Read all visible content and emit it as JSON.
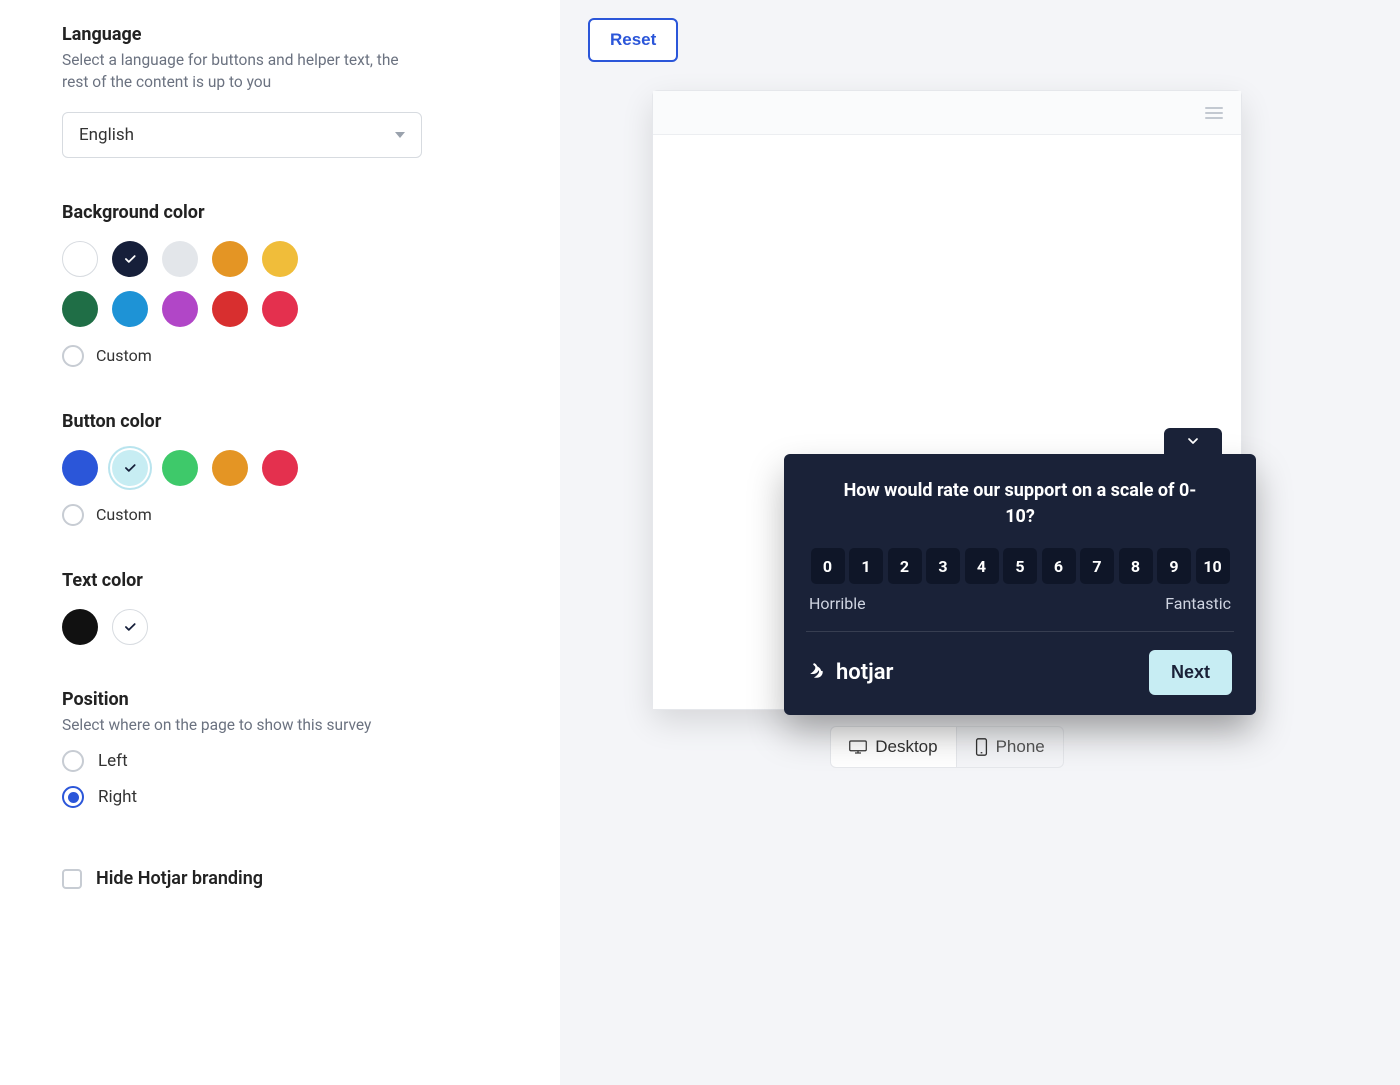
{
  "reset_label": "Reset",
  "language": {
    "title": "Language",
    "help": "Select a language for buttons and helper text, the rest of the content is up to you",
    "selected": "English"
  },
  "background": {
    "title": "Background color",
    "custom_label": "Custom",
    "swatches": [
      "#ffffff",
      "#161f3a",
      "#e3e6ea",
      "#e49524",
      "#f0bd3a",
      "#1f6e46",
      "#1e93d6",
      "#b146c7",
      "#d82f2f",
      "#e4304e"
    ],
    "selected_index": 1
  },
  "button_color": {
    "title": "Button color",
    "custom_label": "Custom",
    "swatches": [
      "#2b56d9",
      "#c7edf3",
      "#3ec96a",
      "#e49524",
      "#e4304e"
    ],
    "selected_index": 1
  },
  "text_color": {
    "title": "Text color",
    "swatches": [
      "#111111",
      "#ffffff"
    ],
    "selected_index": 1
  },
  "position": {
    "title": "Position",
    "help": "Select where on the page to show this survey",
    "options": [
      "Left",
      "Right"
    ],
    "selected_index": 1
  },
  "hide_branding_label": "Hide Hotjar branding",
  "survey": {
    "question": "How would rate our support on a scale of 0-10?",
    "scale": [
      "0",
      "1",
      "2",
      "3",
      "4",
      "5",
      "6",
      "7",
      "8",
      "9",
      "10"
    ],
    "label_low": "Horrible",
    "label_high": "Fantastic",
    "brand": "hotjar",
    "next_label": "Next"
  },
  "devices": {
    "desktop": "Desktop",
    "phone": "Phone",
    "active": "desktop"
  }
}
